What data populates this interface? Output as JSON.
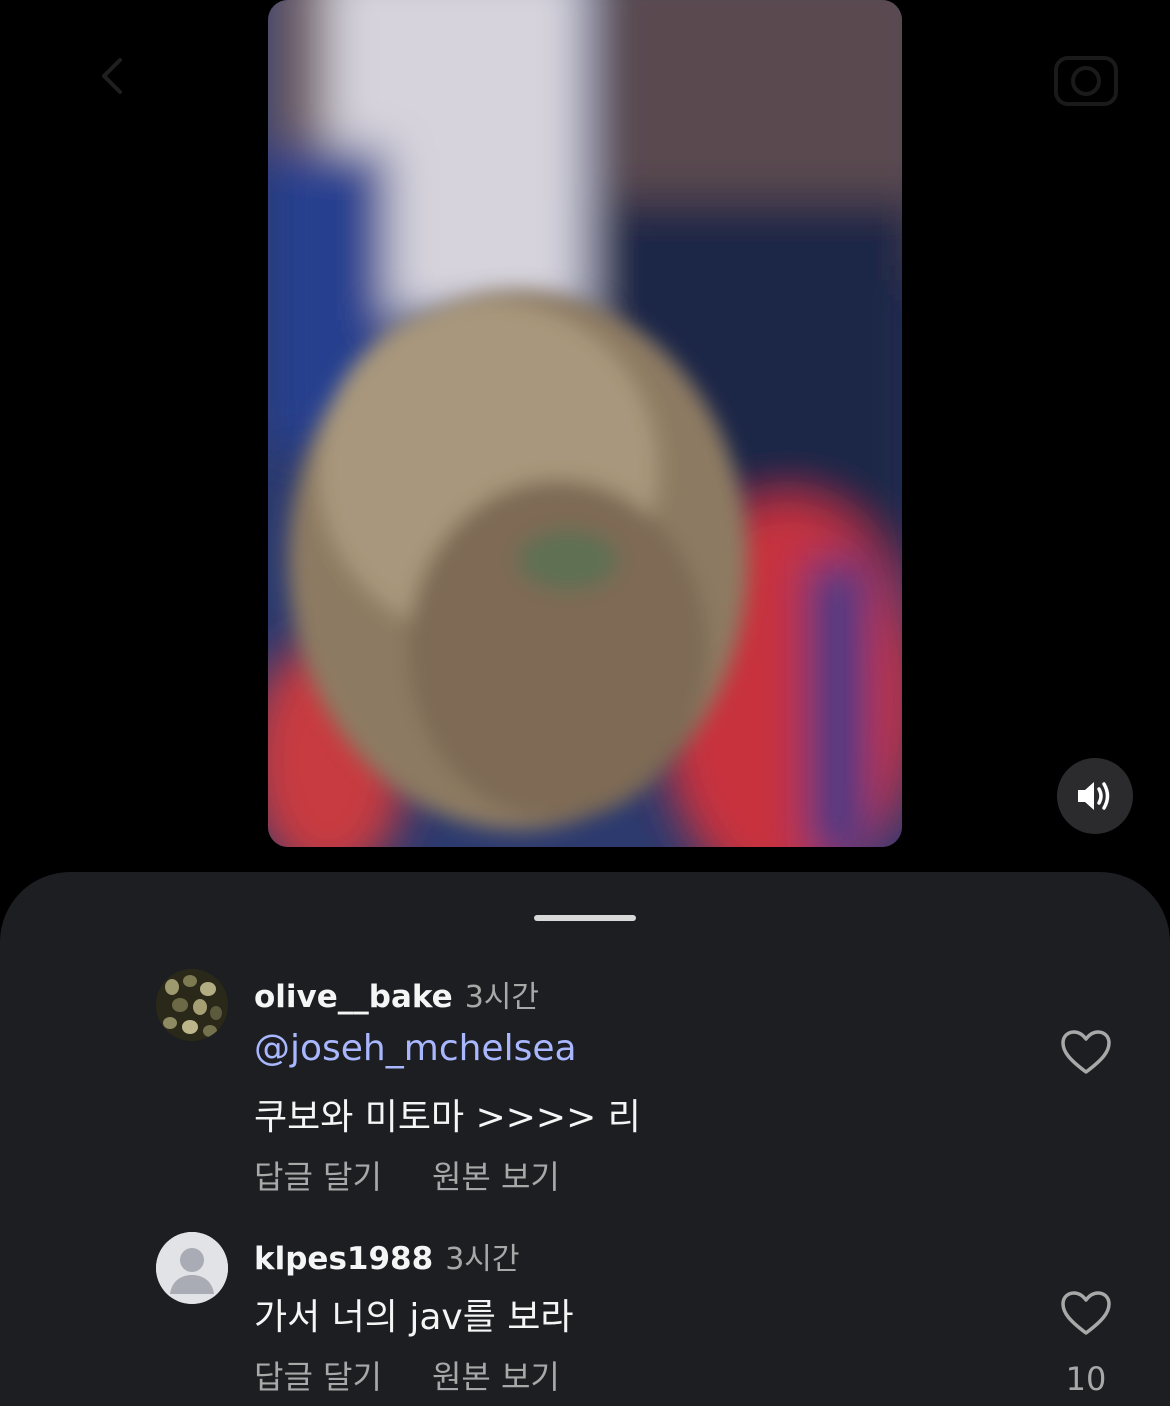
{
  "video": {
    "sound_icon": "speaker-on-icon"
  },
  "comments": [
    {
      "username": "olive__bake",
      "time": "3시간",
      "mention": "@joseh_mchelsea",
      "text": "쿠보와 미토마 >>>> 리",
      "reply_label": "답글 달기",
      "translate_label": "원본 보기",
      "like_icon": "heart-outline-icon",
      "likes": ""
    },
    {
      "username": "klpes1988",
      "time": "3시간",
      "text": "가서 너의 jav를 보라",
      "reply_label": "답글 달기",
      "translate_label": "원본 보기",
      "like_icon": "heart-outline-icon",
      "likes": "10"
    }
  ],
  "colors": {
    "background": "#000000",
    "sheet": "#1c1e22",
    "mention": "#a9b7ff",
    "secondary_text": "#a8a8a8"
  }
}
